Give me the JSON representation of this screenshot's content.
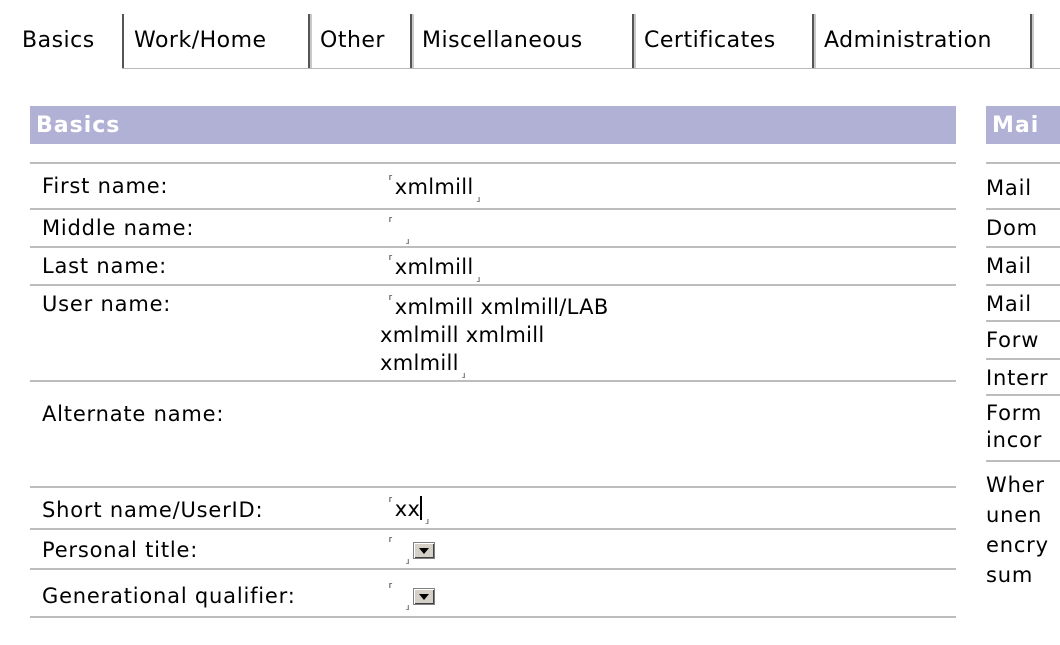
{
  "tabs": [
    {
      "label": "Basics",
      "active": true
    },
    {
      "label": "Work/Home",
      "active": false
    },
    {
      "label": "Other",
      "active": false
    },
    {
      "label": "Miscellaneous",
      "active": false
    },
    {
      "label": "Certificates",
      "active": false
    },
    {
      "label": "Administration",
      "active": false
    }
  ],
  "basics": {
    "header": "Basics",
    "first_name": {
      "label": "First name:",
      "value": "xmlmill"
    },
    "middle_name": {
      "label": "Middle name:",
      "value": ""
    },
    "last_name": {
      "label": "Last name:",
      "value": "xmlmill"
    },
    "user_name": {
      "label": "User name:",
      "lines": [
        "xmlmill xmlmill/LAB",
        "xmlmill xmlmill",
        "xmlmill"
      ]
    },
    "alternate_name": {
      "label": "Alternate name:"
    },
    "short_name": {
      "label": "Short name/UserID:",
      "value": "xx"
    },
    "personal_title": {
      "label": "Personal title:",
      "value": ""
    },
    "generational_qualifier": {
      "label": "Generational qualifier:",
      "value": ""
    }
  },
  "mail": {
    "header": "Mai",
    "rows": [
      "Mail",
      "Dom",
      "Mail",
      "Mail",
      "Forw",
      "Interr",
      "Form\nincor",
      "Wher\nunen\nencry\nsum"
    ]
  },
  "marks": {
    "open": "⸢",
    "close": "⸥"
  }
}
